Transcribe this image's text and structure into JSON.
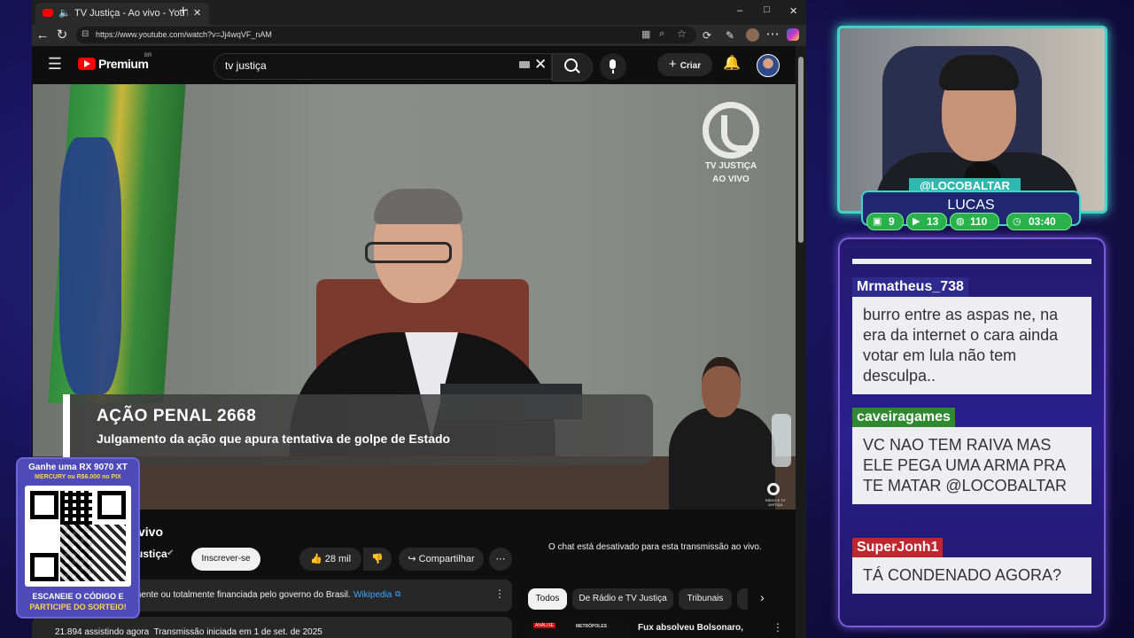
{
  "tab": {
    "title": "TV Justiça - Ao vivo - YouTub"
  },
  "window": {
    "minimize": "–",
    "maximize": "□",
    "close": "✕"
  },
  "address": {
    "url": "https://www.youtube.com/watch?v=Jj4wqVF_nAM"
  },
  "youtube": {
    "logo_text": "Premium",
    "logo_region": "BR",
    "search_value": "tv justiça",
    "create_label": "Criar",
    "video": {
      "overlay_logo_line1": "TV JUSTIÇA",
      "overlay_logo_line2": "AO VIVO",
      "lower_third_title": "AÇÃO PENAL 2668",
      "lower_third_subtitle": "Julgamento da ação que apura tentativa de golpe de Estado",
      "corner_logo": "RÁDIO E TV JUSTIÇA"
    },
    "title_partial": "vivo",
    "channel_partial": "ustiça",
    "subscribe_label": "Inscrever-se",
    "likes": "28 mil",
    "share_label": "Compartilhar",
    "info_text": "mente ou totalmente financiada pelo governo do Brasil.",
    "info_link": "Wikipedia",
    "stats": "21.894 assistindo agora  Transmissão iniciada em 1 de set. de 2025",
    "chat_disabled": "O chat está desativado para esta transmissão ao vivo.",
    "chips": [
      "Todos",
      "De Rádio e TV Justiça",
      "Tribunais"
    ],
    "rec_title": "Fux absolveu Bolsonaro,",
    "rec_badge": "ANÁLISE",
    "rec_source": "METRÓPOLES"
  },
  "stream": {
    "handle": "@LOCOBALTAR",
    "name": "LUCAS",
    "stats": [
      {
        "icon": "twitch-icon",
        "value": "9"
      },
      {
        "icon": "youtube-icon",
        "value": "13"
      },
      {
        "icon": "kick-icon",
        "value": "110"
      },
      {
        "icon": "clock-icon",
        "value": "03:40"
      }
    ],
    "chat": [
      {
        "user": "Mrmatheus_738",
        "color": "#2e2b8f",
        "text": "burro entre as aspas ne, na era da internet o cara ainda votar em lula não tem desculpa.."
      },
      {
        "user": "caveiragames",
        "color": "#2f8a2f",
        "text": "VC NAO TEM RAIVA MAS ELE PEGA UMA ARMA PRA TE MATAR @LOCOBALTAR"
      },
      {
        "user": "SuperJonh1",
        "color": "#c0262e",
        "text": "TÁ CONDENADO AGORA?"
      }
    ]
  },
  "promo": {
    "line1": "Ganhe uma RX 9070 XT",
    "line2": "MERCURY ou R$6.000 no PIX",
    "footer1": "ESCANEIE O CÓDIGO E",
    "footer2": "PARTICIPE DO SORTEIO!"
  }
}
